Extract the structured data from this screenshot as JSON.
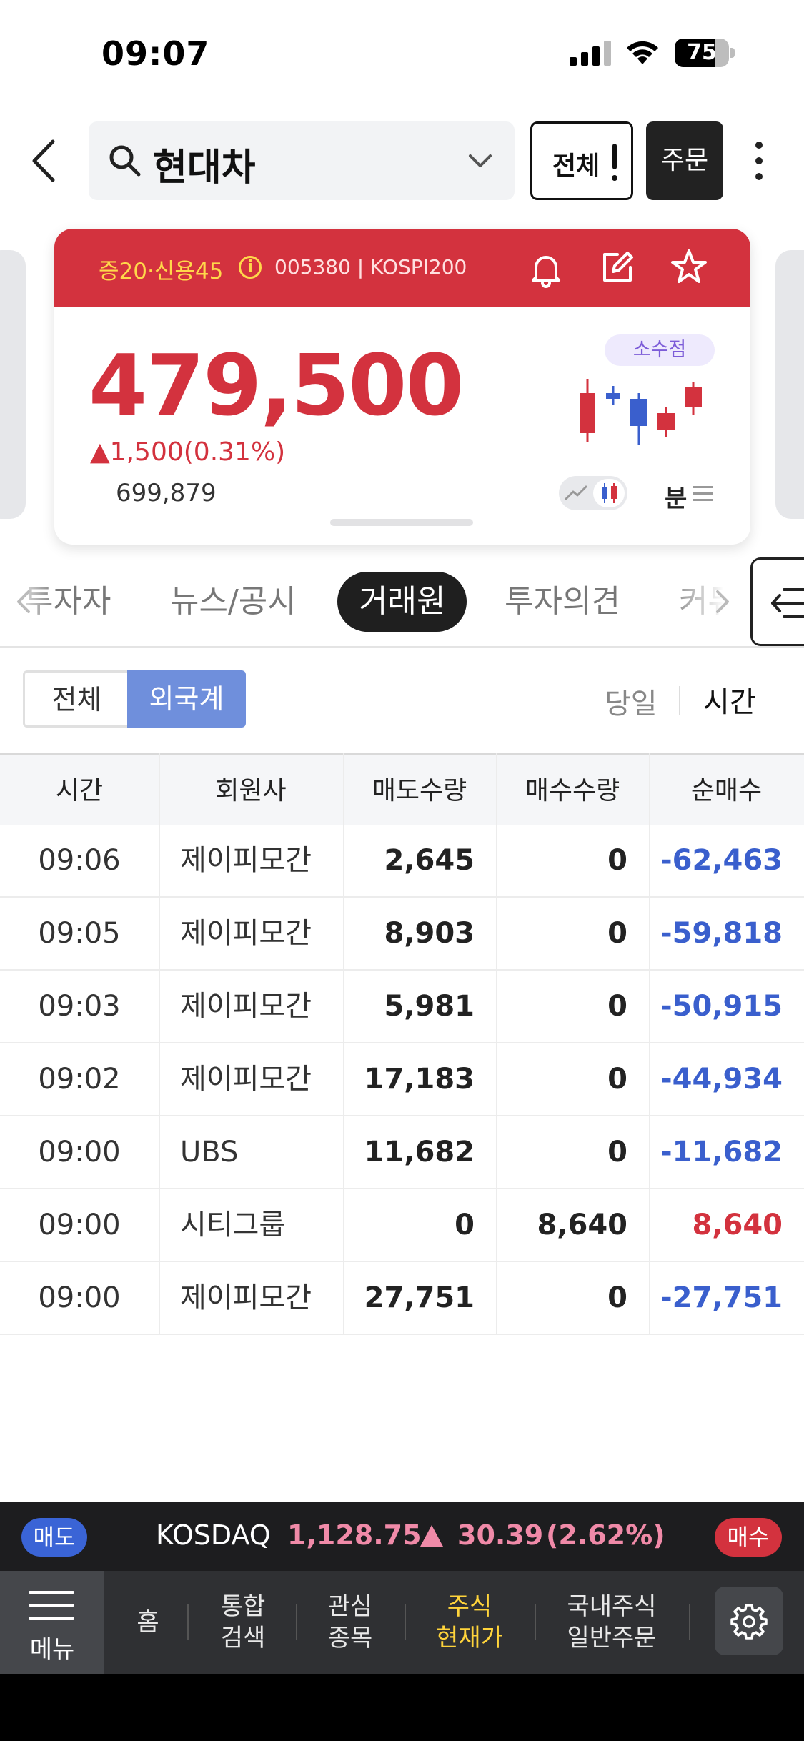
{
  "status_bar": {
    "time": "09:07",
    "battery": "75",
    "battery_level": 0.75
  },
  "header": {
    "search_text": "현대차",
    "all_label": "전체",
    "order_label": "주문"
  },
  "stock": {
    "badges": "증20·신용45",
    "code": "005380 | KOSPI200",
    "price": "479,500",
    "change": "▲1,500(0.31%)",
    "volume": "699,879",
    "decimal_label": "소수점",
    "interval_label": "분",
    "colors": {
      "up": "#d3323e",
      "down": "#3a5fcd"
    }
  },
  "tabs": {
    "items": [
      {
        "label": "투자자"
      },
      {
        "label": "뉴스/공시"
      },
      {
        "label": "거래원",
        "active": true
      },
      {
        "label": "투자의견"
      },
      {
        "label": "커뮤"
      }
    ]
  },
  "filter": {
    "all": "전체",
    "foreign": "외국계",
    "today": "당일",
    "time": "시간"
  },
  "table": {
    "headers": [
      "시간",
      "회원사",
      "매도수량",
      "매수수량",
      "순매수"
    ],
    "rows": [
      {
        "time": "09:06",
        "member": "제이피모간",
        "sell": "2,645",
        "buy": "0",
        "net": "-62,463",
        "dir": "neg"
      },
      {
        "time": "09:05",
        "member": "제이피모간",
        "sell": "8,903",
        "buy": "0",
        "net": "-59,818",
        "dir": "neg"
      },
      {
        "time": "09:03",
        "member": "제이피모간",
        "sell": "5,981",
        "buy": "0",
        "net": "-50,915",
        "dir": "neg"
      },
      {
        "time": "09:02",
        "member": "제이피모간",
        "sell": "17,183",
        "buy": "0",
        "net": "-44,934",
        "dir": "neg"
      },
      {
        "time": "09:00",
        "member": "UBS",
        "sell": "11,682",
        "buy": "0",
        "net": "-11,682",
        "dir": "neg"
      },
      {
        "time": "09:00",
        "member": "시티그룹",
        "sell": "0",
        "buy": "8,640",
        "net": "8,640",
        "dir": "pos"
      },
      {
        "time": "09:00",
        "member": "제이피모간",
        "sell": "27,751",
        "buy": "0",
        "net": "-27,751",
        "dir": "neg"
      }
    ]
  },
  "ticker": {
    "sell_label": "매도",
    "buy_label": "매수",
    "index_name": "KOSDAQ",
    "value": "1,128.75",
    "change": "30.39",
    "pct": "(2.62%)"
  },
  "bottom_nav": {
    "menu_label": "메뉴",
    "items": [
      {
        "line1": "홈",
        "line2": ""
      },
      {
        "line1": "통합",
        "line2": "검색"
      },
      {
        "line1": "관심",
        "line2": "종목"
      },
      {
        "line1": "주식",
        "line2": "현재가",
        "active": true
      },
      {
        "line1": "국내주식",
        "line2": "일반주문"
      }
    ]
  }
}
